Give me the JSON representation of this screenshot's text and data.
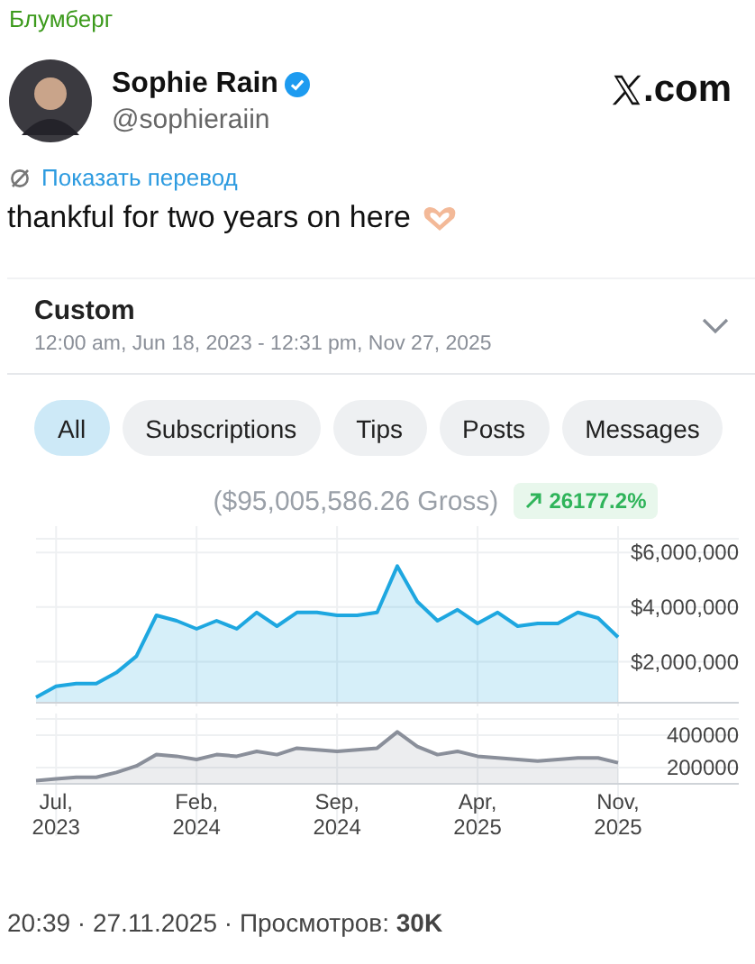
{
  "source": "Блумберг",
  "post": {
    "name": "Sophie Rain",
    "verified": true,
    "handle": "@sophieraiin",
    "site": ".com",
    "translate_link": "Показать перевод",
    "text": "thankful for two years on here"
  },
  "period": {
    "label": "Custom",
    "range": "12:00 am, Jun 18, 2023 - 12:31 pm, Nov 27, 2025"
  },
  "filters": [
    {
      "label": "All",
      "selected": true
    },
    {
      "label": "Subscriptions",
      "selected": false
    },
    {
      "label": "Tips",
      "selected": false
    },
    {
      "label": "Posts",
      "selected": false
    },
    {
      "label": "Messages",
      "selected": false
    }
  ],
  "gross": "($95,005,586.26 Gross)",
  "change": "26177.2%",
  "earnings_chart": {
    "chart_data": {
      "type": "area",
      "categories": [
        null,
        null,
        null,
        null,
        null,
        null,
        null,
        null,
        null,
        null,
        null,
        null,
        null,
        null,
        null,
        null,
        null,
        null,
        null,
        null,
        null,
        null,
        null,
        null,
        null,
        null,
        null,
        null,
        null,
        null
      ],
      "ylim": [
        500000,
        6500000
      ],
      "grid": true,
      "yticks": [
        {
          "value": 2000000,
          "label": "$2,000,000"
        },
        {
          "value": 4000000,
          "label": "$4,000,000"
        },
        {
          "value": 6000000,
          "label": "$6,000,000"
        }
      ],
      "series": [
        {
          "color": "#1ea7e0",
          "values": [
            700000,
            1100000,
            1200000,
            1200000,
            1600000,
            2200000,
            3700000,
            3500000,
            3200000,
            3500000,
            3200000,
            3800000,
            3300000,
            3800000,
            3800000,
            3700000,
            3700000,
            3800000,
            5500000,
            4200000,
            3500000,
            3900000,
            3400000,
            3800000,
            3300000,
            3400000,
            3400000,
            3800000,
            3600000,
            2900000
          ]
        }
      ]
    }
  },
  "count_chart": {
    "chart_data": {
      "type": "area",
      "categories": [
        null,
        "Jul, 2023",
        null,
        null,
        null,
        null,
        null,
        null,
        "Feb, 2024",
        null,
        null,
        null,
        null,
        null,
        null,
        "Sep, 2024",
        null,
        null,
        null,
        null,
        null,
        null,
        "Apr, 2025",
        null,
        null,
        null,
        null,
        null,
        null,
        "Nov, 2025"
      ],
      "ylim": [
        100000,
        500000
      ],
      "grid": true,
      "yticks": [
        {
          "value": 200000,
          "label": "200000"
        },
        {
          "value": 400000,
          "label": "400000"
        }
      ],
      "series": [
        {
          "color": "#8a8f9a",
          "values": [
            120000,
            130000,
            140000,
            140000,
            170000,
            210000,
            280000,
            270000,
            250000,
            280000,
            270000,
            300000,
            280000,
            320000,
            310000,
            300000,
            310000,
            320000,
            420000,
            330000,
            280000,
            300000,
            270000,
            260000,
            250000,
            240000,
            250000,
            260000,
            260000,
            230000
          ]
        }
      ]
    }
  },
  "footer": "20:39 · 27.11.2025 · Просмотров: **30K**"
}
